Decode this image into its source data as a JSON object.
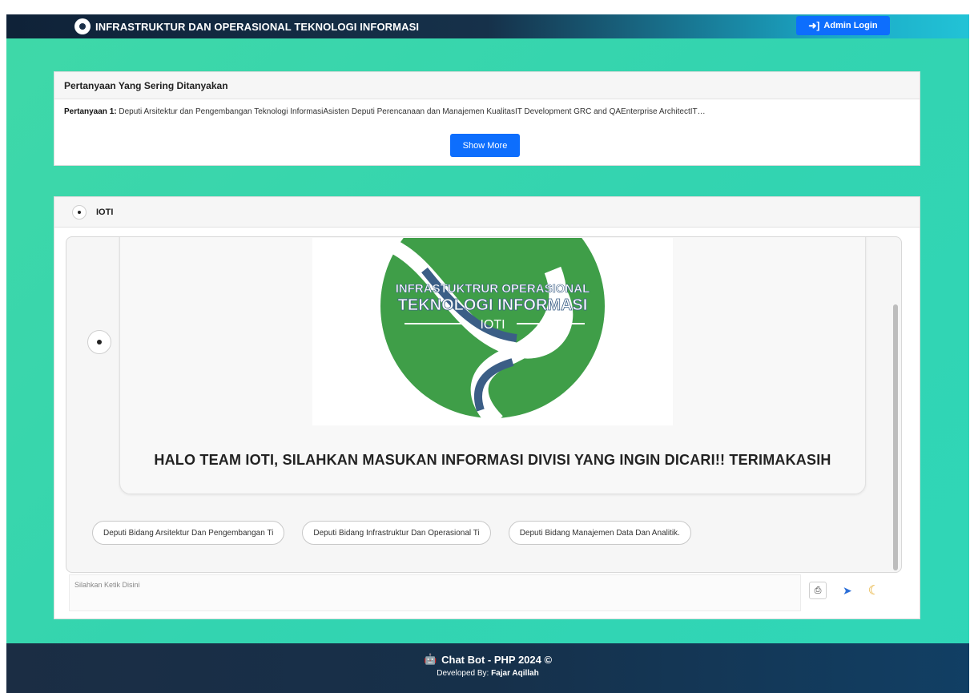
{
  "navbar": {
    "title": "INFRASTRUKTUR DAN OPERASIONAL TEKNOLOGI INFORMASI",
    "admin_login": "Admin Login"
  },
  "faq": {
    "heading": "Pertanyaan Yang Sering Ditanyakan",
    "question_label": "Pertanyaan 1:",
    "question_text": "Deputi Arsitektur dan Pengembangan Teknologi InformasiAsisten Deputi Perencanaan dan Manajemen KualitasIT Development GRC and QAEnterprise ArchitectIT…",
    "show_more": "Show More"
  },
  "chat": {
    "header_title": "IOTI",
    "logo": {
      "line1": "INFRASTUKTRUR OPERASIONAL",
      "line2": "TEKNOLOGI INFORMASI",
      "line3": "IOTI"
    },
    "message": "HALO TEAM IOTI, SILAHKAN MASUKAN INFORMASI DIVISI YANG INGIN DICARI!! TERIMAKASIH",
    "chips": [
      "Deputi Bidang Arsitektur Dan Pengembangan Ti",
      "Deputi Bidang Infrastruktur Dan Operasional Ti",
      "Deputi Bidang Manajemen Data Dan Analitik."
    ],
    "input_placeholder": "Silahkan Ketik Disini"
  },
  "footer": {
    "title": "Chat Bot - PHP 2024 ©",
    "developed_label": "Developed By:",
    "developer": "Fajar Aqillah"
  },
  "icons": [
    "login-arrow-icon",
    "printer-icon",
    "send-icon",
    "moon-icon",
    "robot-icon"
  ],
  "colors": {
    "accent": "#0d6efd",
    "background": "#36d6ad",
    "navbar": "#16314a",
    "logo_green": "#3f9e48",
    "logo_blue": "#3b5e86"
  }
}
